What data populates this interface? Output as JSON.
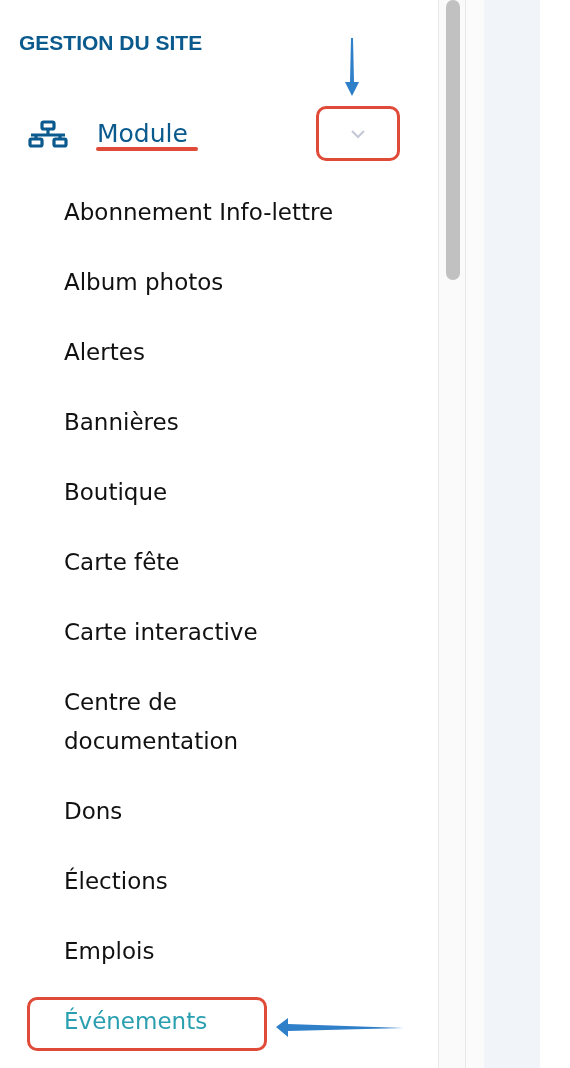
{
  "sidebar": {
    "heading": "GESTION DU SITE",
    "section": {
      "label": "Module",
      "expanded": true,
      "items": [
        {
          "label": "Abonnement Info-lettre",
          "selected": false
        },
        {
          "label": "Album photos",
          "selected": false
        },
        {
          "label": "Alertes",
          "selected": false
        },
        {
          "label": "Bannières",
          "selected": false
        },
        {
          "label": "Boutique",
          "selected": false
        },
        {
          "label": "Carte fête",
          "selected": false
        },
        {
          "label": "Carte interactive",
          "selected": false
        },
        {
          "label": "Centre de documentation",
          "selected": false
        },
        {
          "label": "Dons",
          "selected": false
        },
        {
          "label": "Élections",
          "selected": false
        },
        {
          "label": "Emplois",
          "selected": false
        },
        {
          "label": "Événements",
          "selected": true
        }
      ]
    }
  }
}
